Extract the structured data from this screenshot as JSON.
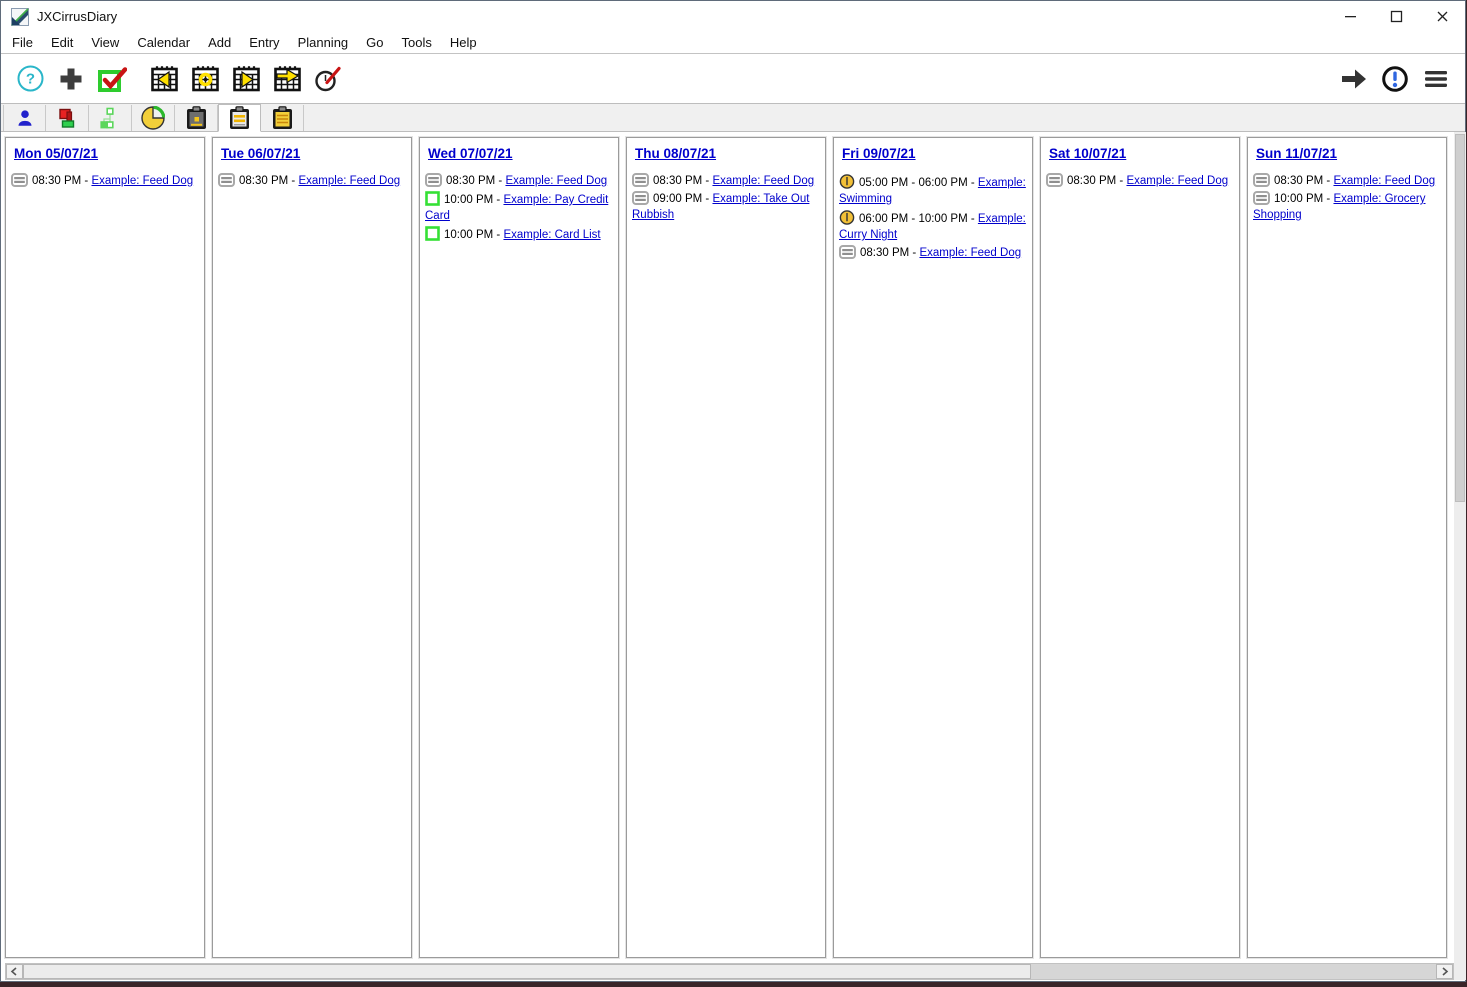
{
  "window": {
    "title": "JXCirrusDiary",
    "controls": [
      {
        "name": "minimize-button",
        "icon": "minimize-icon"
      },
      {
        "name": "maximize-button",
        "icon": "maximize-icon"
      },
      {
        "name": "close-button",
        "icon": "close-icon"
      }
    ]
  },
  "menu_items": [
    "File",
    "Edit",
    "View",
    "Calendar",
    "Add",
    "Entry",
    "Planning",
    "Go",
    "Tools",
    "Help"
  ],
  "toolbar_left": [
    {
      "name": "help-button",
      "icon": "help-icon"
    },
    {
      "name": "add-entry-button",
      "icon": "plus-icon"
    },
    {
      "name": "new-task-button",
      "icon": "task-check-icon"
    },
    {
      "name": "prev-day-button",
      "icon": "calendar-prev-icon",
      "group_gap": true
    },
    {
      "name": "today-button",
      "icon": "calendar-today-icon"
    },
    {
      "name": "next-day-button",
      "icon": "calendar-next-icon"
    },
    {
      "name": "goto-date-button",
      "icon": "calendar-goto-icon"
    },
    {
      "name": "record-time-button",
      "icon": "clock-pen-icon"
    }
  ],
  "toolbar_right": [
    {
      "name": "forward-button",
      "icon": "arrow-right-icon"
    },
    {
      "name": "alarm-button",
      "icon": "alarm-clock-icon"
    },
    {
      "name": "app-menu-button",
      "icon": "hamburger-icon"
    }
  ],
  "view_tabs": [
    {
      "name": "tab-people",
      "icon": "person-icon",
      "selected": false
    },
    {
      "name": "tab-tasks",
      "icon": "tasks-icon",
      "selected": false
    },
    {
      "name": "tab-project-tree",
      "icon": "project-tree-icon",
      "selected": false
    },
    {
      "name": "tab-time-dial",
      "icon": "time-gauge-icon",
      "selected": false
    },
    {
      "name": "tab-day-view",
      "icon": "day-view-icon",
      "selected": false
    },
    {
      "name": "tab-week-view",
      "icon": "week-view-icon",
      "selected": true
    },
    {
      "name": "tab-month-view",
      "icon": "month-view-icon",
      "selected": false
    }
  ],
  "entry_separator": " - ",
  "calendar": {
    "days": [
      {
        "header": "Mon 05/07/21",
        "entries": [
          {
            "icon": "repeat-icon",
            "time": "08:30 PM",
            "title": "Example: Feed Dog"
          }
        ]
      },
      {
        "header": "Tue 06/07/21",
        "entries": [
          {
            "icon": "repeat-icon",
            "time": "08:30 PM",
            "title": "Example: Feed Dog"
          }
        ]
      },
      {
        "header": "Wed 07/07/21",
        "entries": [
          {
            "icon": "repeat-icon",
            "time": "08:30 PM",
            "title": "Example: Feed Dog"
          },
          {
            "icon": "todo-icon",
            "time": "10:00 PM",
            "title": "Example: Pay Credit Card"
          },
          {
            "icon": "todo-icon",
            "time": "10:00 PM",
            "title": "Example: Card List"
          }
        ]
      },
      {
        "header": "Thu 08/07/21",
        "entries": [
          {
            "icon": "repeat-icon",
            "time": "08:30 PM",
            "title": "Example: Feed Dog"
          },
          {
            "icon": "repeat-icon",
            "time": "09:00 PM",
            "title": "Example: Take Out Rubbish"
          }
        ]
      },
      {
        "header": "Fri 09/07/21",
        "entries": [
          {
            "icon": "clock-icon",
            "time": "05:00 PM - 06:00 PM",
            "title": "Example: Swimming"
          },
          {
            "icon": "clock-icon",
            "time": "06:00 PM - 10:00 PM",
            "title": "Example: Curry Night"
          },
          {
            "icon": "repeat-icon",
            "time": "08:30 PM",
            "title": "Example: Feed Dog"
          }
        ]
      },
      {
        "header": "Sat 10/07/21",
        "entries": [
          {
            "icon": "repeat-icon",
            "time": "08:30 PM",
            "title": "Example: Feed Dog"
          }
        ]
      },
      {
        "header": "Sun 11/07/21",
        "entries": [
          {
            "icon": "repeat-icon",
            "time": "08:30 PM",
            "title": "Example: Feed Dog"
          },
          {
            "icon": "repeat-icon",
            "time": "10:00 PM",
            "title": "Example: Grocery Shopping"
          }
        ]
      }
    ]
  },
  "colors": {
    "link_blue": "#0000cc",
    "accent_yellow": "#f2c037",
    "accent_green": "#2ecc2e",
    "accent_red": "#c81414",
    "help_teal": "#2ab6c9",
    "alarm_blue": "#2f66e0"
  }
}
